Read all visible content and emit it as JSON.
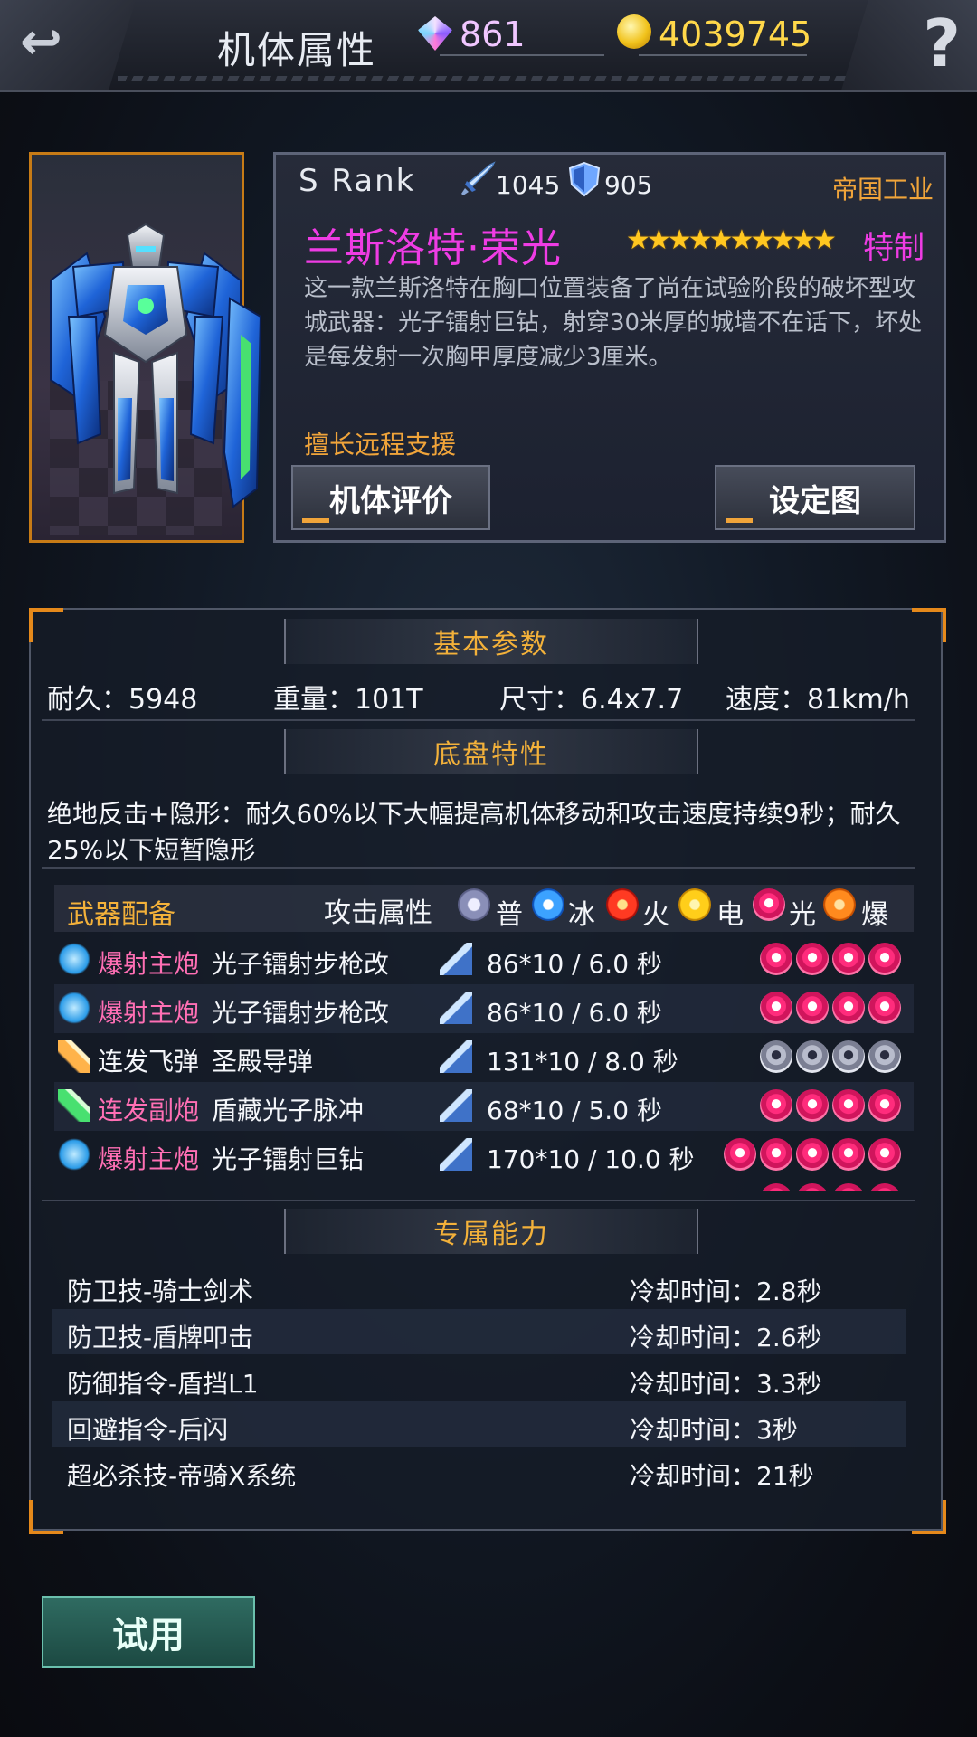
{
  "header": {
    "title": "机体属性",
    "gems": "861",
    "gold": "4039745"
  },
  "mech": {
    "rank": "S  Rank",
    "attack": "1045",
    "defense": "905",
    "maker": "帝国工业",
    "name": "兰斯洛特·荣光",
    "stars": "★★★★★★★★★★",
    "star_count": 10,
    "special_tag": "特制",
    "description": "这一款兰斯洛特在胸口位置装备了尚在试验阶段的破坏型攻城武器：光子镭射巨钻，射穿30米厚的城墙不在话下，坏处是每发射一次胸甲厚度减少3厘米。",
    "specialty": "擅长远程支援",
    "btn_eval": "机体评价",
    "btn_setting": "设定图"
  },
  "basic": {
    "title": "基本参数",
    "durability": "耐久：5948",
    "weight": "重量：101T",
    "size": "尺寸：6.4x7.7",
    "speed": "速度：81km/h"
  },
  "chassis": {
    "title": "底盘特性",
    "text": "绝地反击+隐形：耐久60%以下大幅提高机体移动和攻击速度持续9秒；耐久25%以下短暂隐形"
  },
  "weapons": {
    "header_label": "武器配备",
    "attr_label": "攻击属性",
    "elements": [
      "普",
      "冰",
      "火",
      "电",
      "光",
      "爆"
    ],
    "rows": [
      {
        "type": "爆射主炮",
        "name": "光子镭射步枪改",
        "stat": "86*10 / 6.0 秒"
      },
      {
        "type": "爆射主炮",
        "name": "光子镭射步枪改",
        "stat": "86*10 / 6.0 秒"
      },
      {
        "type": "连发飞弹",
        "name": "圣殿导弹",
        "stat": "131*10 / 8.0 秒"
      },
      {
        "type": "连发副炮",
        "name": "盾藏光子脉冲",
        "stat": "68*10 / 5.0 秒"
      },
      {
        "type": "爆射主炮",
        "name": "光子镭射巨钻",
        "stat": "170*10 / 10.0 秒"
      }
    ]
  },
  "abilities": {
    "title": "专属能力",
    "rows": [
      {
        "name": "防卫技-骑士剑术",
        "cooldown": "冷却时间：2.8秒"
      },
      {
        "name": "防卫技-盾牌叩击",
        "cooldown": "冷却时间：2.6秒"
      },
      {
        "name": "防御指令-盾挡L1",
        "cooldown": "冷却时间：3.3秒"
      },
      {
        "name": "回避指令-后闪",
        "cooldown": "冷却时间：3秒"
      },
      {
        "name": "超必杀技-帝骑X系统",
        "cooldown": "冷却时间：21秒"
      }
    ]
  },
  "try_button": "试用",
  "colors": {
    "accent_orange": "#f0a43a",
    "name_magenta": "#ef3ce4",
    "star_gold": "#ffc720",
    "type_pink": "#ff6fb4"
  }
}
